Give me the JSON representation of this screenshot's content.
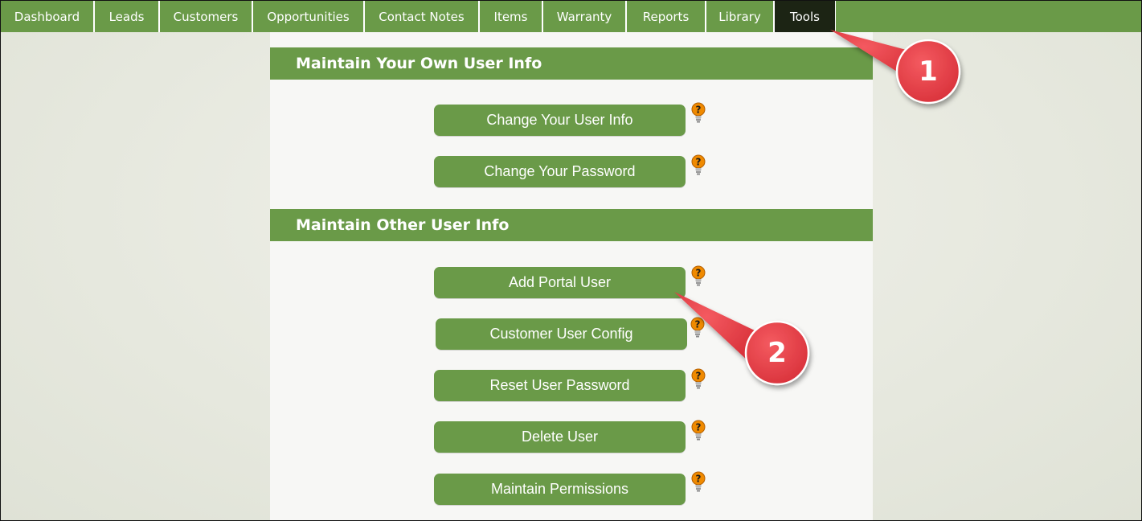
{
  "nav": {
    "items": [
      {
        "label": "Dashboard"
      },
      {
        "label": "Leads"
      },
      {
        "label": "Customers"
      },
      {
        "label": "Opportunities"
      },
      {
        "label": "Contact Notes"
      },
      {
        "label": "Items"
      },
      {
        "label": "Warranty"
      },
      {
        "label": "Reports"
      },
      {
        "label": "Library"
      },
      {
        "label": "Tools",
        "active": true
      }
    ]
  },
  "sections": {
    "own": {
      "title": "Maintain Your Own User Info",
      "buttons": [
        {
          "label": "Change Your User Info"
        },
        {
          "label": "Change Your Password"
        }
      ]
    },
    "other": {
      "title": "Maintain Other User Info",
      "buttons": [
        {
          "label": "Add Portal User"
        },
        {
          "label": "Customer User Config"
        },
        {
          "label": "Reset User Password"
        },
        {
          "label": "Delete User"
        },
        {
          "label": "Maintain Permissions"
        }
      ]
    }
  },
  "callouts": {
    "one": "1",
    "two": "2"
  },
  "colors": {
    "accent_green": "#6a9a48",
    "active_tab": "#1c2414",
    "callout_red": "#e8434b",
    "help_orange": "#f08a00"
  },
  "icons": {
    "help": "help-lightbulb-icon"
  }
}
